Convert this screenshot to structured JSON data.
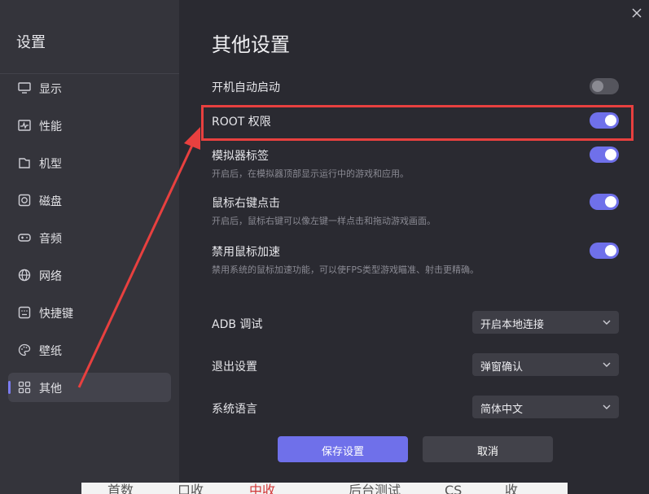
{
  "sidebar": {
    "title": "设置",
    "items": [
      {
        "label": "显示",
        "icon": "monitor-icon"
      },
      {
        "label": "性能",
        "icon": "activity-icon"
      },
      {
        "label": "机型",
        "icon": "device-icon"
      },
      {
        "label": "磁盘",
        "icon": "disk-icon"
      },
      {
        "label": "音频",
        "icon": "gamepad-icon"
      },
      {
        "label": "网络",
        "icon": "globe-icon"
      },
      {
        "label": "快捷键",
        "icon": "keyboard-icon"
      },
      {
        "label": "壁纸",
        "icon": "palette-icon"
      },
      {
        "label": "其他",
        "icon": "grid-icon",
        "active": true
      }
    ]
  },
  "main": {
    "title": "其他设置",
    "toggles": [
      {
        "title": "开机自动启动",
        "desc": "",
        "on": false
      },
      {
        "title": "ROOT 权限",
        "desc": "",
        "on": true
      },
      {
        "title": "模拟器标签",
        "desc": "开启后，在模拟器顶部显示运行中的游戏和应用。",
        "on": true
      },
      {
        "title": "鼠标右键点击",
        "desc": "开启后，鼠标右键可以像左键一样点击和拖动游戏画面。",
        "on": true
      },
      {
        "title": "禁用鼠标加速",
        "desc": "禁用系统的鼠标加速功能，可以使FPS类型游戏瞄准、射击更精确。",
        "on": true
      }
    ],
    "selects": [
      {
        "label": "ADB 调试",
        "value": "开启本地连接"
      },
      {
        "label": "退出设置",
        "value": "弹窗确认"
      },
      {
        "label": "系统语言",
        "value": "简体中文"
      }
    ],
    "buttons": {
      "save": "保存设置",
      "cancel": "取消"
    }
  },
  "taskbar": {
    "items": [
      "首数",
      "口收",
      "中收",
      "后台测试",
      "CS",
      "收"
    ]
  },
  "colors": {
    "accent": "#6f70ea",
    "annotation": "#e8403f",
    "background": "#2a2a31",
    "sidebar": "#34343b"
  }
}
